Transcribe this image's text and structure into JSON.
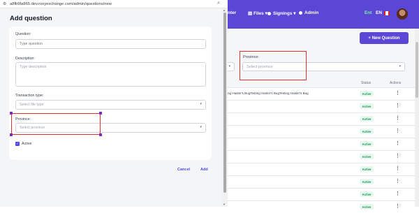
{
  "browser": {
    "url": "a8fb9fa865.dev.rosyexchange.com/admin/questions/new"
  },
  "background": {
    "nav": {
      "center_partial": "nter",
      "files": "Files",
      "signings": "Signings",
      "admin": "Admin",
      "lang_ent": "Ent",
      "lang_en": "EN"
    },
    "new_question_button": "+ New Question",
    "province_filter": {
      "label": "Province:",
      "placeholder": "Select province"
    },
    "table": {
      "status_header": "Status",
      "actions_header": "Actions",
      "rows": [
        {
          "text": "ng Hasler's BugTesting Hasler's BugTesting Hasler's Bug",
          "status": "Active"
        },
        {
          "text": "",
          "status": "Active"
        },
        {
          "text": "",
          "status": "Active"
        },
        {
          "text": "",
          "status": "Active"
        },
        {
          "text": "",
          "status": "Active"
        },
        {
          "text": "",
          "status": "Active"
        },
        {
          "text": "",
          "status": "Active"
        },
        {
          "text": "",
          "status": "Active"
        },
        {
          "text": "",
          "status": "Active"
        },
        {
          "text": "",
          "status": "Active"
        }
      ]
    }
  },
  "drawer": {
    "title": "Add question",
    "fields": {
      "question": {
        "label": "Question:",
        "placeholder": "Type question"
      },
      "description": {
        "label": "Description:",
        "placeholder": "Type description"
      },
      "transaction_type": {
        "label": "Transaction type:",
        "placeholder": "Select file type"
      },
      "province": {
        "label": "Province:",
        "placeholder": "Select province"
      }
    },
    "active": {
      "label": "Active",
      "checked": true
    },
    "cancel": "Cancel",
    "add": "Add"
  },
  "colors": {
    "primary": "#5b47d6",
    "highlight": "#e03131",
    "active_badge": "#14915a"
  },
  "icons": {
    "site_info": "tune-icon",
    "search": "search-icon",
    "caret": "chevron-down-icon",
    "kebab": "more-vertical-icon"
  }
}
